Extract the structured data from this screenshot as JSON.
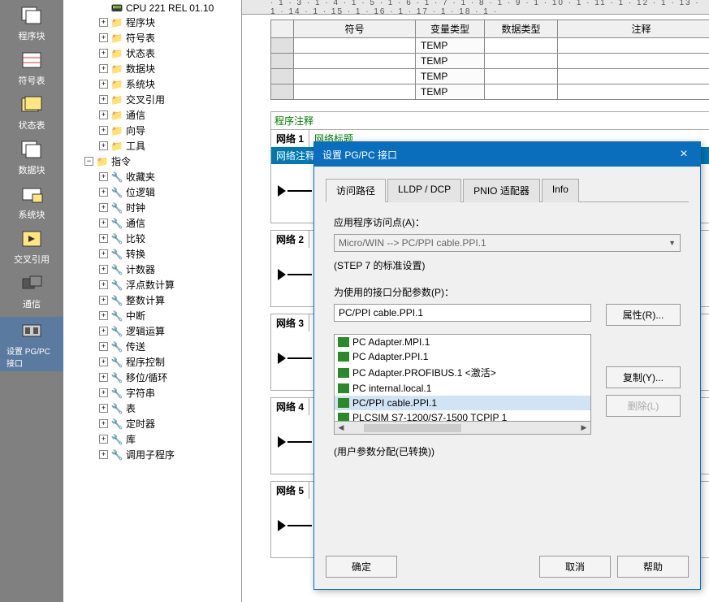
{
  "toolbar": [
    {
      "name": "program-block",
      "label": "程序块"
    },
    {
      "name": "symbol-table",
      "label": "符号表"
    },
    {
      "name": "status-table",
      "label": "状态表"
    },
    {
      "name": "data-block",
      "label": "数据块"
    },
    {
      "name": "system-block",
      "label": "系统块"
    },
    {
      "name": "cross-ref",
      "label": "交叉引用"
    },
    {
      "name": "communication",
      "label": "通信"
    },
    {
      "name": "pgpc-interface",
      "label": "设置 PG/PC 接口",
      "active": true
    }
  ],
  "tree": {
    "cpu": "CPU 221 REL 01.10",
    "group1": [
      {
        "label": "程序块"
      },
      {
        "label": "符号表"
      },
      {
        "label": "状态表"
      },
      {
        "label": "数据块"
      },
      {
        "label": "系统块"
      },
      {
        "label": "交叉引用"
      },
      {
        "label": "通信"
      },
      {
        "label": "向导"
      },
      {
        "label": "工具"
      }
    ],
    "instr_label": "指令",
    "instr": [
      {
        "label": "收藏夹"
      },
      {
        "label": "位逻辑"
      },
      {
        "label": "时钟"
      },
      {
        "label": "通信"
      },
      {
        "label": "比较"
      },
      {
        "label": "转换"
      },
      {
        "label": "计数器"
      },
      {
        "label": "浮点数计算"
      },
      {
        "label": "整数计算"
      },
      {
        "label": "中断"
      },
      {
        "label": "逻辑运算"
      },
      {
        "label": "传送"
      },
      {
        "label": "程序控制"
      },
      {
        "label": "移位/循环"
      },
      {
        "label": "字符串"
      },
      {
        "label": "表"
      },
      {
        "label": "定时器"
      },
      {
        "label": "库"
      },
      {
        "label": "调用子程序"
      }
    ]
  },
  "ruler": "· 1 · 3 · 1 · 4 · 1 · 5 · 1 · 6 · 1 · 7 · 1 · 8 · 1 · 9 · 1 · 10 · 1 · 11 · 1 · 12 · 1 · 13 · 1 · 14 · 1 · 15 · 1 · 16 · 1 · 17 · 1 · 18 · 1 ·",
  "var_table": {
    "headers": [
      "",
      "符号",
      "变量类型",
      "数据类型",
      "注释"
    ],
    "rows": [
      {
        "sym": "",
        "vtype": "TEMP",
        "dtype": "",
        "comment": ""
      },
      {
        "sym": "",
        "vtype": "TEMP",
        "dtype": "",
        "comment": ""
      },
      {
        "sym": "",
        "vtype": "TEMP",
        "dtype": "",
        "comment": ""
      },
      {
        "sym": "",
        "vtype": "TEMP",
        "dtype": "",
        "comment": ""
      }
    ]
  },
  "prog": {
    "comment": "程序注释",
    "nets": [
      {
        "num": "网络 1",
        "title": "网络标题",
        "comment": "网络注释"
      },
      {
        "num": "网络 2",
        "title": "",
        "comment": ""
      },
      {
        "num": "网络 3",
        "title": "",
        "comment": ""
      },
      {
        "num": "网络 4",
        "title": "",
        "comment": ""
      },
      {
        "num": "网络 5",
        "title": "",
        "comment": ""
      }
    ]
  },
  "dialog": {
    "title": "设置 PG/PC 接口",
    "tabs": [
      "访问路径",
      "LLDP / DCP",
      "PNIO 适配器",
      "Info"
    ],
    "app_point_label": "应用程序访问点(A)：",
    "app_point_value": "Micro/WIN       --> PC/PPI cable.PPI.1",
    "std_note": "(STEP 7 的标准设置)",
    "assign_label": "为使用的接口分配参数(P)：",
    "assign_value": "PC/PPI cable.PPI.1",
    "btn_props": "属性(R)...",
    "btn_copy": "复制(Y)...",
    "btn_delete": "删除(L)",
    "list": [
      "PC Adapter.MPI.1",
      "PC Adapter.PPI.1",
      "PC Adapter.PROFIBUS.1  <激活>",
      "PC internal.local.1",
      "PC/PPI cable.PPI.1",
      "PLCSIM S7-1200/S7-1500 TCPIP 1"
    ],
    "selected_index": 4,
    "convert_note": "(用户参数分配(已转换))",
    "ok": "确定",
    "cancel": "取消",
    "help": "帮助"
  }
}
